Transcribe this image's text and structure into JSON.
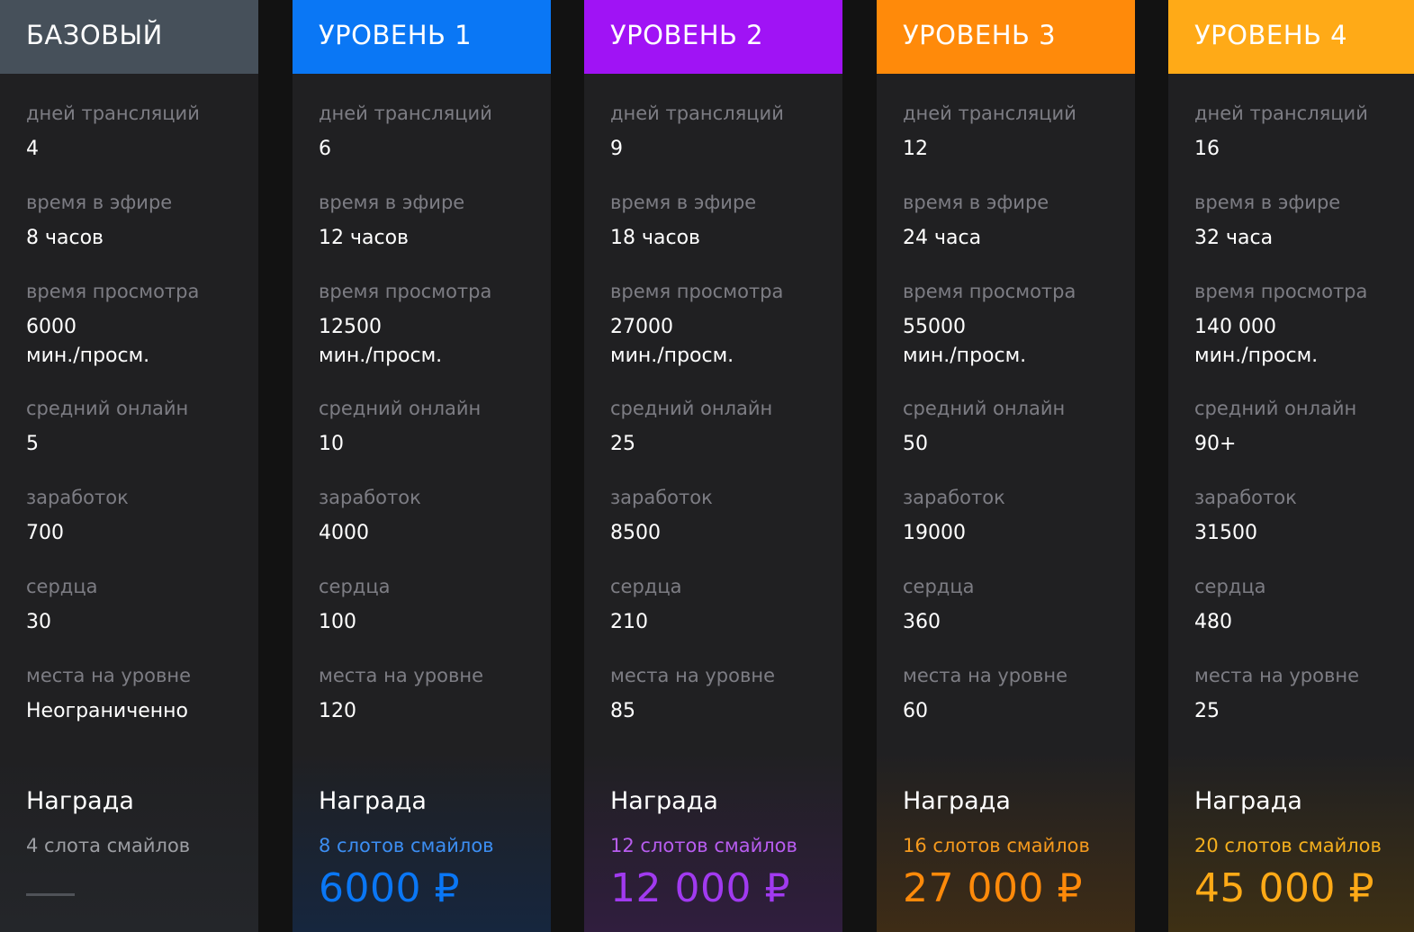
{
  "labels": {
    "days": "дней трансляций",
    "airtime": "время в эфире",
    "watchtime": "время просмотра",
    "online": "средний онлайн",
    "earnings": "заработок",
    "hearts": "сердца",
    "seats": "места на уровне",
    "reward": "Награда"
  },
  "colors": {
    "basic": "#46505a",
    "level1": "#0a77f5",
    "level2": "#a013f5",
    "level3": "#ff8a0a",
    "level4": "#ffaa17",
    "level1_text": "#3c8ef2",
    "level2_text": "#b85df0",
    "level3_text": "#f59a1e",
    "level4_text": "#f5b01e",
    "basic_text": "#9c9ea3"
  },
  "tiers": [
    {
      "name": "БАЗОВЫЙ",
      "days": "4",
      "airtime": "8 часов",
      "watchtime": "6000\nмин./просм.",
      "online": "5",
      "earnings": "700",
      "hearts": "30",
      "seats": "Неограниченно",
      "reward_slots": "4 слота смайлов",
      "reward_price": ""
    },
    {
      "name": "УРОВЕНЬ 1",
      "days": "6",
      "airtime": "12 часов",
      "watchtime": "12500\nмин./просм.",
      "online": "10",
      "earnings": "4000",
      "hearts": "100",
      "seats": "120",
      "reward_slots": "8 слотов смайлов",
      "reward_price": "6000 ₽"
    },
    {
      "name": "УРОВЕНЬ 2",
      "days": "9",
      "airtime": "18 часов",
      "watchtime": "27000\nмин./просм.",
      "online": "25",
      "earnings": "8500",
      "hearts": "210",
      "seats": "85",
      "reward_slots": "12 слотов смайлов",
      "reward_price": "12 000 ₽"
    },
    {
      "name": "УРОВЕНЬ 3",
      "days": "12",
      "airtime": "24 часа",
      "watchtime": "55000\nмин./просм.",
      "online": "50",
      "earnings": "19000",
      "hearts": "360",
      "seats": "60",
      "reward_slots": "16 слотов смайлов",
      "reward_price": "27 000 ₽"
    },
    {
      "name": "УРОВЕНЬ 4",
      "days": "16",
      "airtime": "32 часа",
      "watchtime": "140 000\nмин./просм.",
      "online": "90+",
      "earnings": "31500",
      "hearts": "480",
      "seats": "25",
      "reward_slots": "20 слотов смайлов",
      "reward_price": "45 000 ₽"
    }
  ]
}
